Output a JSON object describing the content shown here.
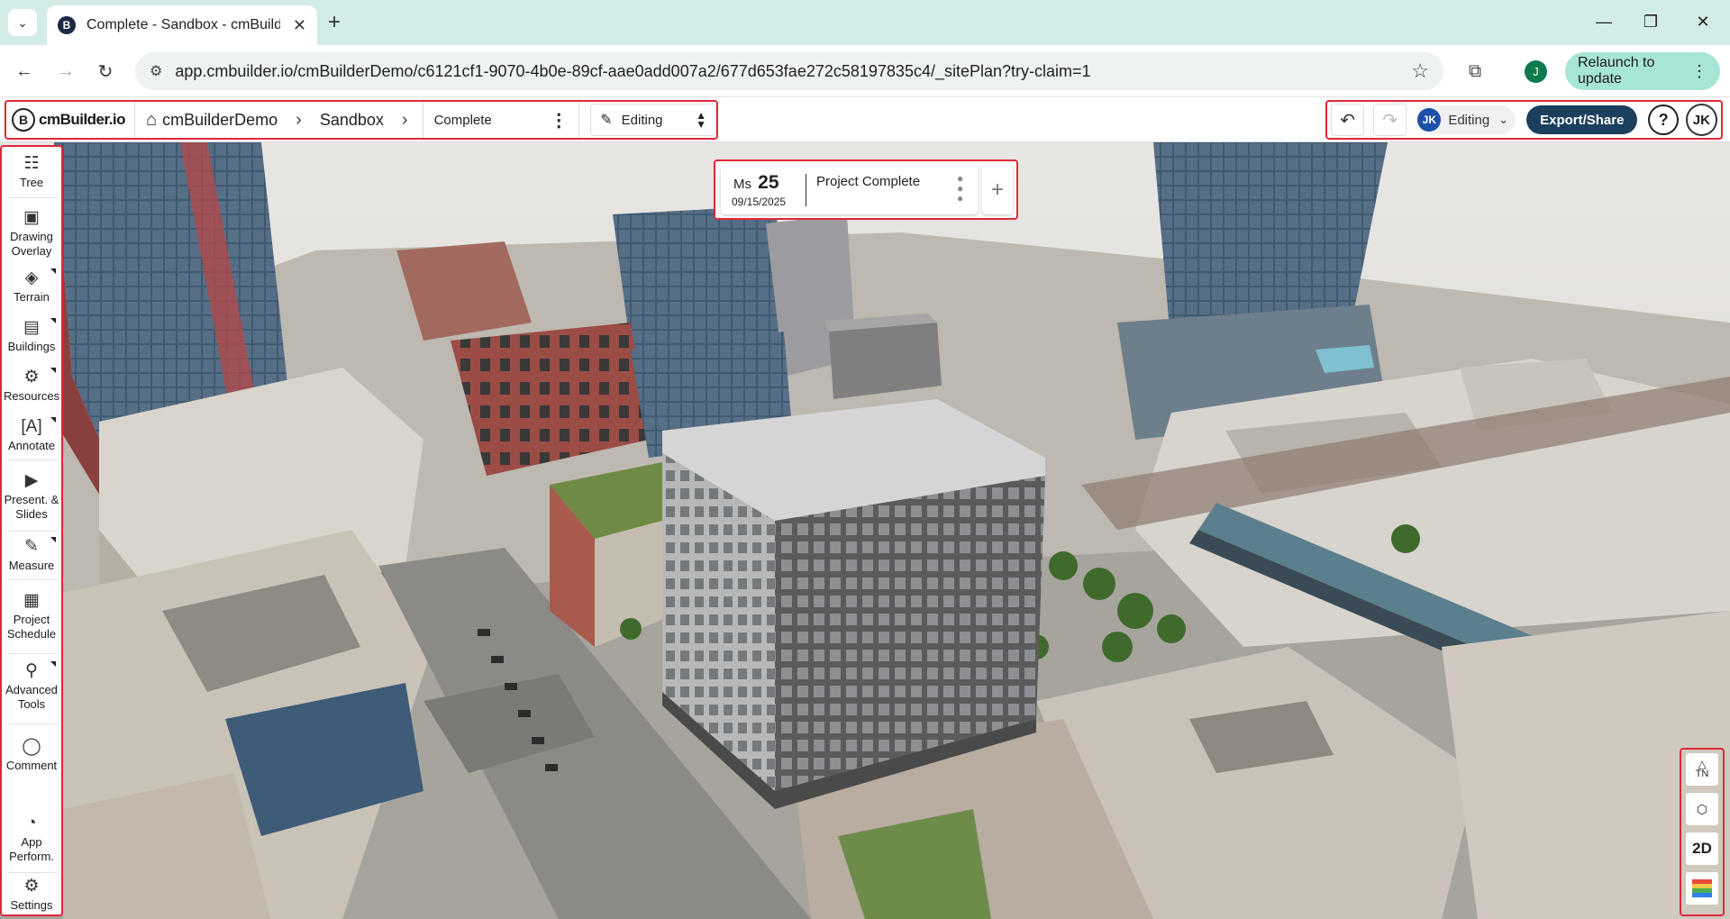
{
  "browser": {
    "tab_title": "Complete - Sandbox - cmBuilder",
    "url": "app.cmbuilder.io/cmBuilderDemo/c6121cf1-9070-4b0e-89cf-aae0add007a2/677d653fae272c58197835c4/_sitePlan?try-claim=1",
    "profile_initial": "J",
    "relaunch_label": "Relaunch to update"
  },
  "header": {
    "logo_text": "cmBuilder.io",
    "breadcrumb": [
      "cmBuilderDemo",
      "Sandbox"
    ],
    "scenario": "Complete",
    "mode": "Editing",
    "collaborator_initials": "JK",
    "collaborator_mode": "Editing",
    "export_label": "Export/Share",
    "help_label": "?",
    "user_initials": "JK"
  },
  "toolbar": {
    "tree": "Tree",
    "drawing_overlay_1": "Drawing",
    "drawing_overlay_2": "Overlay",
    "terrain": "Terrain",
    "buildings": "Buildings",
    "resources": "Resources",
    "annotate": "Annotate",
    "present_1": "Present. &",
    "present_2": "Slides",
    "measure": "Measure",
    "schedule_1": "Project",
    "schedule_2": "Schedule",
    "advanced_1": "Advanced",
    "advanced_2": "Tools",
    "comment": "Comment",
    "perf_1": "App",
    "perf_2": "Perform.",
    "settings": "Settings"
  },
  "milestone": {
    "prefix": "Ms",
    "number": "25",
    "date": "09/15/2025",
    "name": "Project Complete"
  },
  "view_tools": {
    "north_label": "TN",
    "mode_2d": "2D"
  },
  "colors": {
    "highlight": "#e0283a",
    "export_button": "#1b3f5e",
    "collaborator_avatar": "#1d4fa8",
    "relaunch_button": "#a7e5d6"
  }
}
